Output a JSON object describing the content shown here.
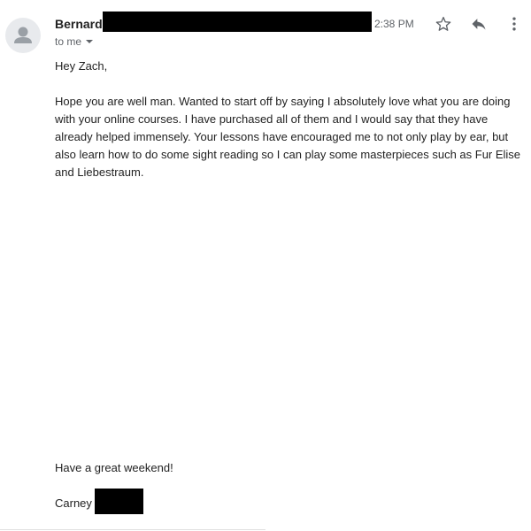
{
  "email": {
    "sender_name": "Bernard,",
    "time": "2:38 PM",
    "recipient_label": "to me",
    "body": {
      "greeting": "Hey Zach,",
      "paragraph": "Hope you are well man. Wanted to start off by saying I absolutely love what you are doing with your online courses. I have purchased all of them and I would say that they have already helped immensely. Your lessons have encouraged me to not only play by ear, but also learn how to do some sight reading so I can play some masterpieces such as Fur Elise and Liebestraum.",
      "closing": "Have a great weekend!",
      "signature": "Carney"
    }
  },
  "icons": {
    "avatar": "person-icon",
    "star": "star-icon",
    "reply": "reply-icon",
    "more": "more-vert-icon",
    "recipient_dropdown": "caret-down-icon"
  },
  "colors": {
    "text": "#222222",
    "secondary_text": "#5f6368",
    "icon": "#5f6368",
    "avatar_bg": "#e8eaed",
    "avatar_fg": "#9aa0a6",
    "redaction": "#000000"
  }
}
